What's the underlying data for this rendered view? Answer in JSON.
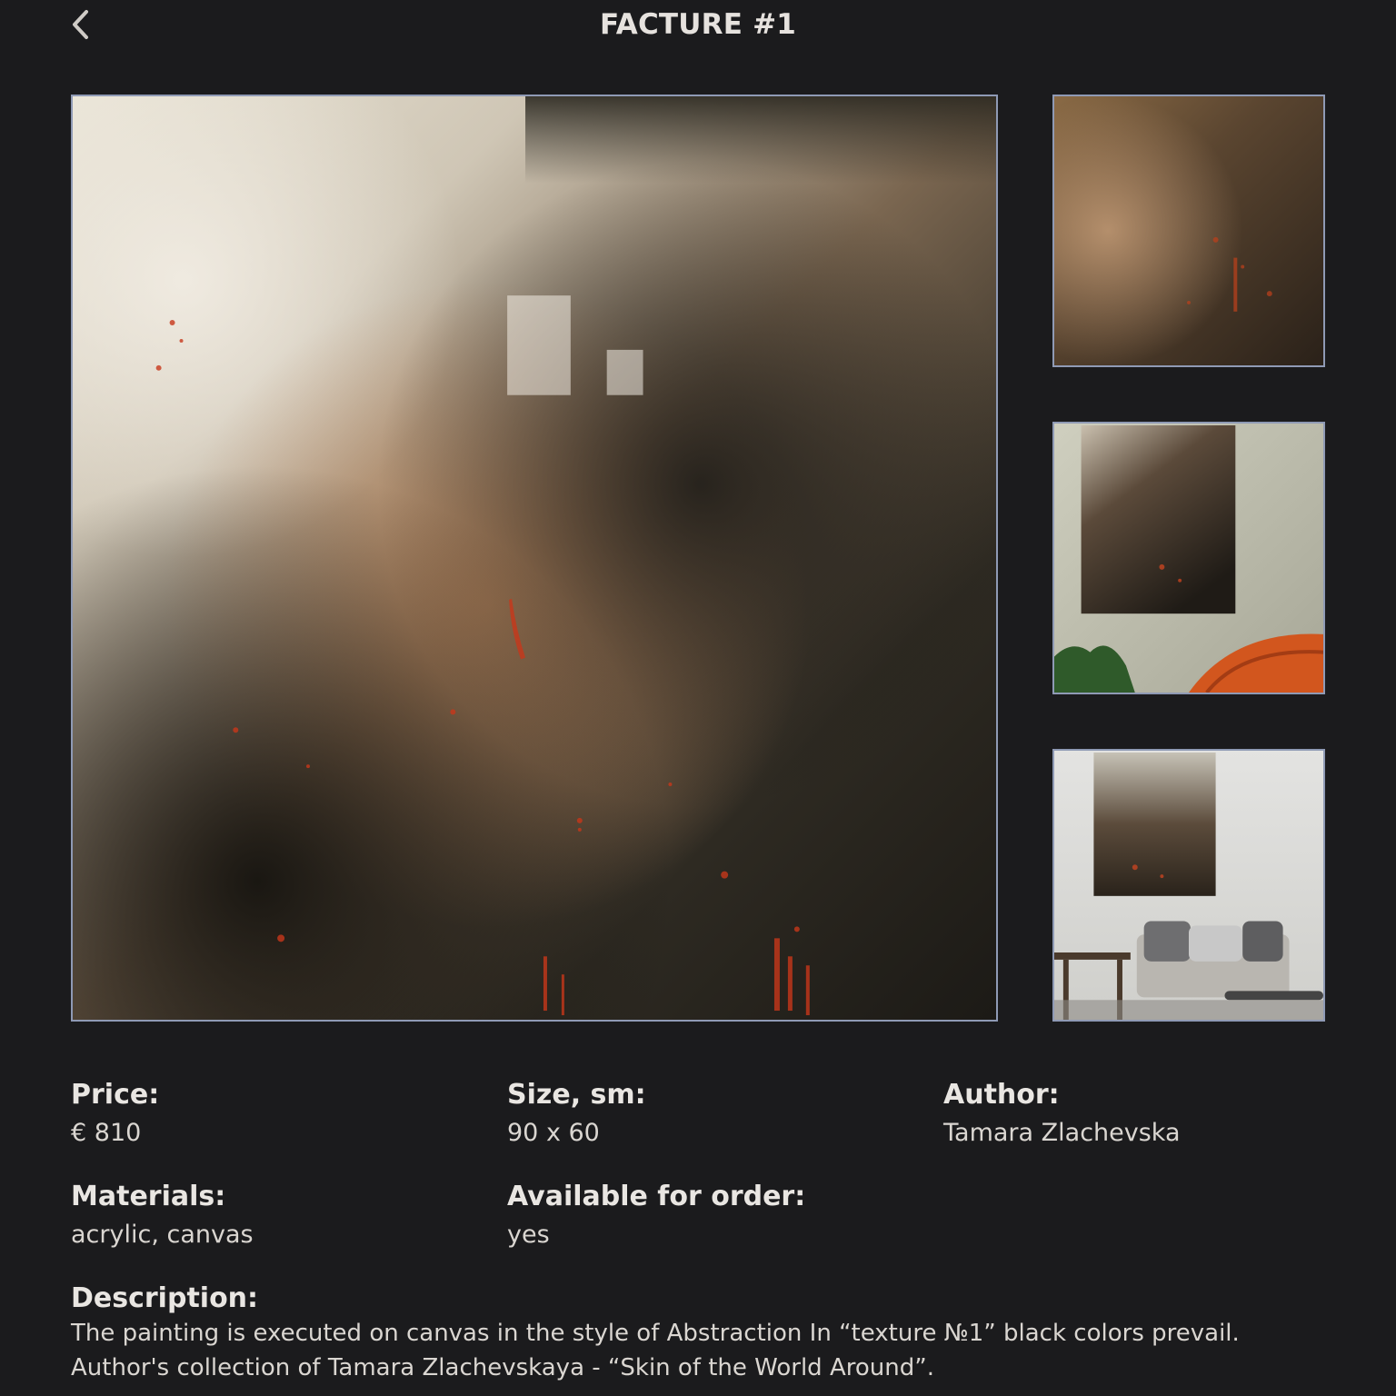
{
  "header": {
    "title": "FACTURE #1",
    "back_icon": "chevron-left-icon"
  },
  "gallery": {
    "main_image": "painting-abstract-texture",
    "thumbnails": [
      "painting-detail",
      "painting-on-wall-with-plant",
      "painting-in-living-room"
    ]
  },
  "details": {
    "price": {
      "label": "Price:",
      "value": "€ 810"
    },
    "size": {
      "label": "Size, sm:",
      "value": "90 x 60"
    },
    "author": {
      "label": "Author:",
      "value": "Tamara Zlachevska"
    },
    "materials": {
      "label": "Materials:",
      "value": "acrylic, canvas"
    },
    "available": {
      "label": "Available for order:",
      "value": "yes"
    }
  },
  "description": {
    "label": "Description:",
    "text": "The painting is executed on canvas in the style of Abstraction In “texture №1” black colors prevail. Author's collection of Tamara Zlachevskaya - “Skin of the World Around”."
  },
  "colors": {
    "background": "#1b1b1d",
    "image_border": "#8f9ab5",
    "text": "#e9e6e2"
  }
}
